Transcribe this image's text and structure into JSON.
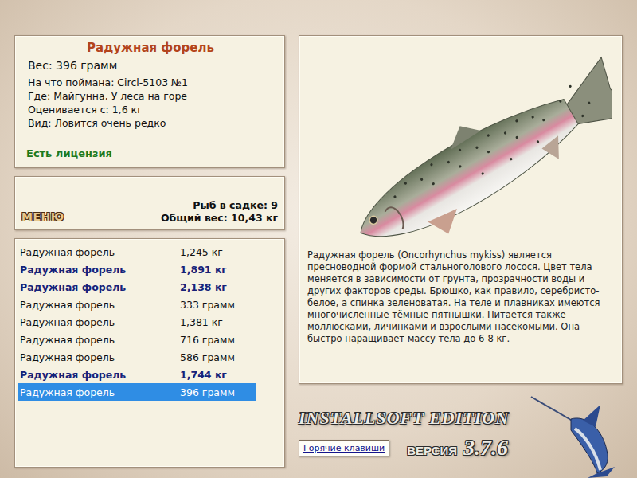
{
  "info": {
    "title": "Радужная форель",
    "weight": "Вес: 396 грамм",
    "details": [
      "На что поймана: Circl-5103 №1",
      "Где: Майгунна, У леса на горе",
      "Оценивается с: 1,6 кг",
      "Вид: Ловится очень редко"
    ],
    "license": "Есть лицензия"
  },
  "menu": {
    "button": "МЕНЮ",
    "count": "Рыб в садке: 9",
    "total": "Общий вес: 10,43 кг"
  },
  "catch_list": [
    {
      "name": "Радужная форель",
      "weight": "1,245 кг",
      "trophy": false,
      "selected": false
    },
    {
      "name": "Радужная форель",
      "weight": "1,891 кг",
      "trophy": true,
      "selected": false
    },
    {
      "name": "Радужная форель",
      "weight": "2,138 кг",
      "trophy": true,
      "selected": false
    },
    {
      "name": "Радужная форель",
      "weight": "333 грамм",
      "trophy": false,
      "selected": false
    },
    {
      "name": "Радужная форель",
      "weight": "1,381 кг",
      "trophy": false,
      "selected": false
    },
    {
      "name": "Радужная форель",
      "weight": "716 грамм",
      "trophy": false,
      "selected": false
    },
    {
      "name": "Радужная форель",
      "weight": "586 грамм",
      "trophy": false,
      "selected": false
    },
    {
      "name": "Радужная форель",
      "weight": "1,744 кг",
      "trophy": true,
      "selected": false
    },
    {
      "name": "Радужная форель",
      "weight": "396 грамм",
      "trophy": false,
      "selected": true
    }
  ],
  "description": "Радужная форель (Oncorhynchus mykiss) является пресноводной формой стальноголового лосося. Цвет тела меняется в зависимости от грунта, прозрачности воды и других факторов среды. Брюшко, как правило, серебристо-белое, а спинка зеленоватая. На теле и плавниках имеются многочисленные тёмные пятнышки. Питается также моллюсками, личинками и взрослыми насекомыми. Она быстро наращивает массу тела до 6-8 кг.",
  "branding": {
    "edition": "INSTALLSOFT EDITION",
    "version_label": "ВЕРСИЯ",
    "version": "3.7.6"
  },
  "hotkeys_button": "Горячие клавиши"
}
